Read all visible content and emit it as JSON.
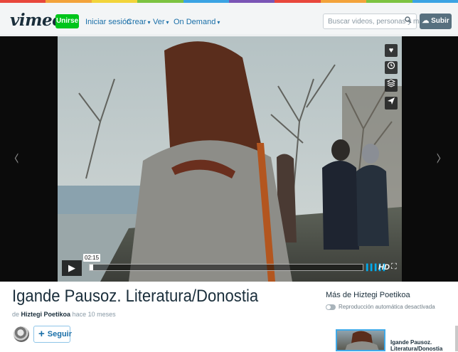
{
  "colors": {
    "stripe": [
      "#e8473c",
      "#f3a33b",
      "#f2d43a",
      "#7dc341",
      "#3aa3e3",
      "#7a55b5",
      "#e8473c",
      "#f3a33b",
      "#7dc341",
      "#3aa3e3"
    ],
    "accent_green": "#00c51a",
    "link_blue": "#1a6fa8",
    "progress_blue": "#00adef"
  },
  "header": {
    "logo": "vimeo",
    "join_label": "Unirse",
    "nav": [
      {
        "label": "Iniciar sesión",
        "has_dropdown": false
      },
      {
        "label": "Crear",
        "has_dropdown": true
      },
      {
        "label": "Ver",
        "has_dropdown": true
      },
      {
        "label": "On Demand",
        "has_dropdown": true
      }
    ],
    "search_placeholder": "Buscar videos, personas y más",
    "upload_label": "Subir",
    "search_icon": "search-icon",
    "upload_icon": "upload-cloud-icon"
  },
  "player": {
    "current_time": "02:15",
    "progress": 0.012,
    "hd_label": "HD",
    "side_actions": [
      "heart-icon",
      "clock-icon",
      "layers-icon",
      "paper-plane-icon"
    ]
  },
  "video_info": {
    "title": "Igande Pausoz. Literatura/Donostia",
    "by_prefix": "de",
    "author": "Hiztegi Poetikoa",
    "time_ago": "hace 10 meses",
    "follow_label": "Seguir"
  },
  "sidebar": {
    "more_from": "Más de Hiztegi Poetikoa",
    "autoplay_label": "Reproducción automática desactivada",
    "autoplay_on": false,
    "related": [
      {
        "title": "Igande Pausoz. Literatura/Donostia"
      }
    ]
  }
}
